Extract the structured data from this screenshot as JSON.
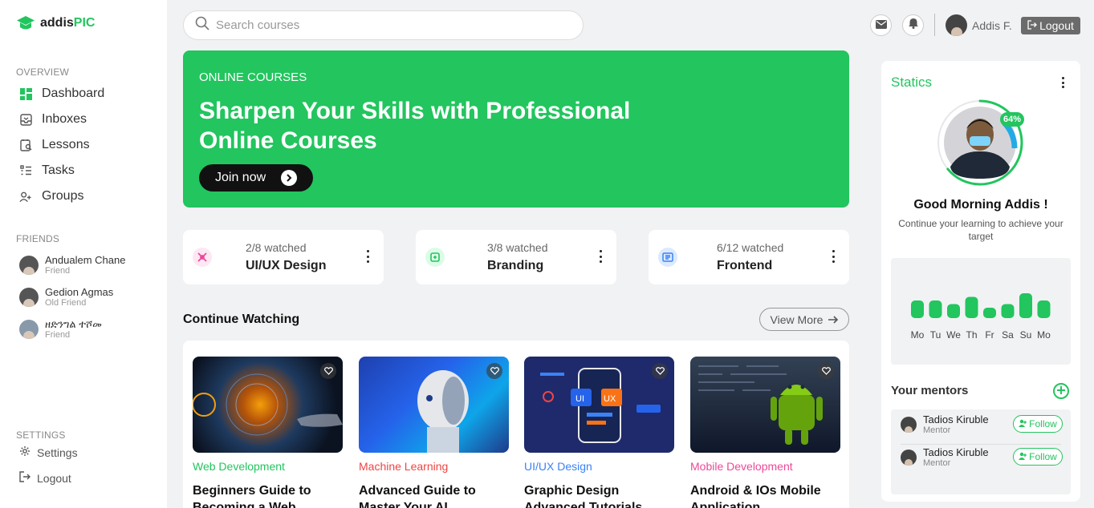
{
  "brand": {
    "name_prefix": "addis",
    "name_suffix": "PIC"
  },
  "sidebar": {
    "overview_label": "OVERVIEW",
    "nav": [
      {
        "label": "Dashboard",
        "icon": "dashboard-icon"
      },
      {
        "label": "Inboxes",
        "icon": "inbox-icon"
      },
      {
        "label": "Lessons",
        "icon": "lessons-icon"
      },
      {
        "label": "Tasks",
        "icon": "tasks-icon"
      },
      {
        "label": "Groups",
        "icon": "groups-icon"
      }
    ],
    "friends_label": "FRIENDS",
    "friends": [
      {
        "name": "Andualem Chane",
        "role": "Friend"
      },
      {
        "name": "Gedion Agmas",
        "role": "Old Friend"
      },
      {
        "name": "ዘድንግል ተሾመ",
        "role": "Friend"
      }
    ],
    "settings_label": "SETTINGS",
    "settings_item": "Settings",
    "logout_item": "Logout"
  },
  "topbar": {
    "search_placeholder": "Search courses",
    "user_name": "Addis F.",
    "logout_label": "Logout"
  },
  "hero": {
    "kicker": "ONLINE COURSES",
    "title": "Sharpen Your Skills with Professional Online Courses",
    "cta": "Join now"
  },
  "progress": [
    {
      "watched": "2/8 watched",
      "title": "UI/UX Design",
      "icon": "pen-tool-icon",
      "color": "#ec4899"
    },
    {
      "watched": "3/8 watched",
      "title": "Branding",
      "icon": "branding-icon",
      "color": "#22c55e"
    },
    {
      "watched": "6/12 watched",
      "title": "Frontend",
      "icon": "frontend-icon",
      "color": "#3b82f6"
    }
  ],
  "continue": {
    "title": "Continue Watching",
    "view_more": "View More",
    "courses": [
      {
        "category": "Web Development",
        "category_color": "#22c55e",
        "title": "Beginners Guide to Becoming a Web"
      },
      {
        "category": "Machine Learning",
        "category_color": "#ef4444",
        "title": "Advanced Guide to Master Your AI"
      },
      {
        "category": "UI/UX Design",
        "category_color": "#3b82f6",
        "title": "Graphic Design Advanced Tutorials"
      },
      {
        "category": "Mobile Development",
        "category_color": "#ec4899",
        "title": "Android & IOs Mobile Application Development"
      }
    ]
  },
  "stats": {
    "title": "Statics",
    "percent": "64%",
    "progress": 0.64,
    "greeting": "Good Morning Addis !",
    "subtitle": "Continue your learning to achieve your target",
    "days": [
      "Mo",
      "Tu",
      "We",
      "Th",
      "Fr",
      "Sa",
      "Su",
      "Mo"
    ],
    "activity": [
      2,
      2,
      1.5,
      2.5,
      1,
      1.5,
      3,
      2
    ]
  },
  "mentors": {
    "title": "Your mentors",
    "list": [
      {
        "name": "Tadios Kiruble",
        "role": "Mentor",
        "follow": "Follow"
      },
      {
        "name": "Tadios Kiruble",
        "role": "Mentor",
        "follow": "Follow"
      }
    ]
  },
  "colors": {
    "accent": "#22c55e"
  }
}
